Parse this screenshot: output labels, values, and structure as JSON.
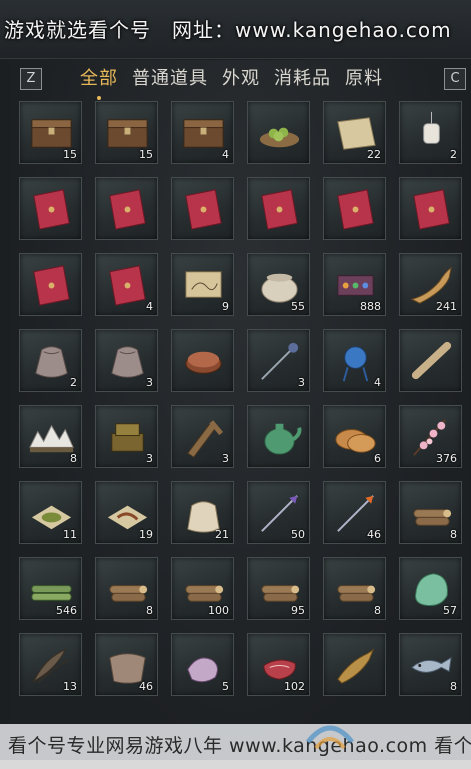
{
  "header": {
    "watermark": "游戏就选看个号　网址：www.kangehao.com"
  },
  "keys": {
    "left": "Z",
    "right": "C"
  },
  "tabs": [
    {
      "label": "全部",
      "active": true
    },
    {
      "label": "普通道具",
      "active": false
    },
    {
      "label": "外观",
      "active": false
    },
    {
      "label": "消耗品",
      "active": false
    },
    {
      "label": "原料",
      "active": false
    }
  ],
  "colors": {
    "accent": "#e6b85a",
    "slot": "#2c3335"
  },
  "items": [
    {
      "icon": "chest-icon",
      "count": "15"
    },
    {
      "icon": "chest-icon",
      "count": "15"
    },
    {
      "icon": "chest-icon",
      "count": "4"
    },
    {
      "icon": "fruit-tray-icon",
      "count": ""
    },
    {
      "icon": "scroll-paper-icon",
      "count": "22"
    },
    {
      "icon": "lantern-icon",
      "count": "2"
    },
    {
      "icon": "red-envelope-icon",
      "count": ""
    },
    {
      "icon": "red-envelope-icon",
      "count": ""
    },
    {
      "icon": "red-envelope-icon",
      "count": ""
    },
    {
      "icon": "red-envelope-icon",
      "count": ""
    },
    {
      "icon": "red-envelope-icon",
      "count": ""
    },
    {
      "icon": "red-envelope-icon",
      "count": ""
    },
    {
      "icon": "red-envelope-icon",
      "count": ""
    },
    {
      "icon": "red-envelope-icon",
      "count": "4"
    },
    {
      "icon": "map-scroll-icon",
      "count": "9"
    },
    {
      "icon": "pottery-jar-icon",
      "count": "55"
    },
    {
      "icon": "jewel-box-icon",
      "count": "888"
    },
    {
      "icon": "horn-icon",
      "count": "241"
    },
    {
      "icon": "pouch-icon",
      "count": "2"
    },
    {
      "icon": "pouch-icon",
      "count": "3"
    },
    {
      "icon": "makeup-box-icon",
      "count": ""
    },
    {
      "icon": "hairpin-icon",
      "count": "3"
    },
    {
      "icon": "blue-charm-icon",
      "count": "4"
    },
    {
      "icon": "rolled-scroll-icon",
      "count": ""
    },
    {
      "icon": "mountain-ornament-icon",
      "count": "8"
    },
    {
      "icon": "seal-icon",
      "count": "3"
    },
    {
      "icon": "ruler-icon",
      "count": "3"
    },
    {
      "icon": "teapot-icon",
      "count": ""
    },
    {
      "icon": "flatbread-icon",
      "count": "6"
    },
    {
      "icon": "blossom-icon",
      "count": "376"
    },
    {
      "icon": "herb-powder-icon",
      "count": "11"
    },
    {
      "icon": "root-powder-icon",
      "count": "19"
    },
    {
      "icon": "sack-icon",
      "count": "21"
    },
    {
      "icon": "arrow-icon",
      "count": "50"
    },
    {
      "icon": "fire-arrow-icon",
      "count": "46"
    },
    {
      "icon": "logs-icon",
      "count": "8"
    },
    {
      "icon": "bamboo-icon",
      "count": "546"
    },
    {
      "icon": "logs-icon",
      "count": "8"
    },
    {
      "icon": "logs-icon",
      "count": "100"
    },
    {
      "icon": "logs-icon",
      "count": "95"
    },
    {
      "icon": "logs-icon",
      "count": "8"
    },
    {
      "icon": "jade-stone-icon",
      "count": "57"
    },
    {
      "icon": "feathers-icon",
      "count": "13"
    },
    {
      "icon": "hide-icon",
      "count": "46"
    },
    {
      "icon": "silk-icon",
      "count": "5"
    },
    {
      "icon": "meat-icon",
      "count": "102"
    },
    {
      "icon": "carp-icon",
      "count": ""
    },
    {
      "icon": "fish-icon",
      "count": "8"
    }
  ],
  "footer": {
    "watermark": "看个号专业网易游戏八年 www.kangehao.com 看个号"
  }
}
